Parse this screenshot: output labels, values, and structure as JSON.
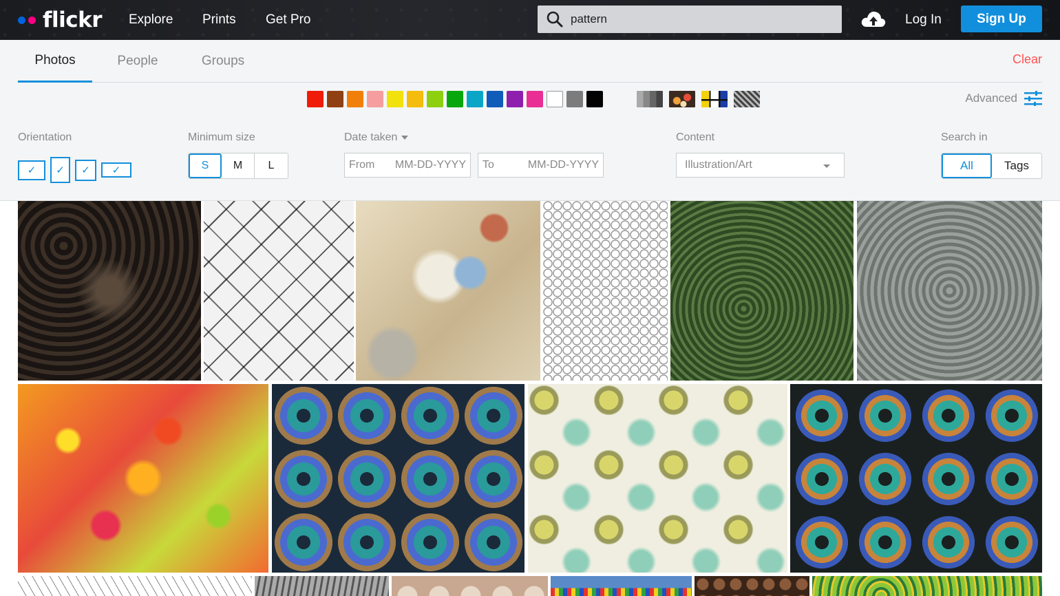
{
  "header": {
    "logo": "flickr",
    "nav": [
      "Explore",
      "Prints",
      "Get Pro"
    ],
    "search_value": "pattern",
    "login": "Log In",
    "signup": "Sign Up"
  },
  "tabs": [
    {
      "label": "Photos",
      "active": true
    },
    {
      "label": "People",
      "active": false
    },
    {
      "label": "Groups",
      "active": false
    }
  ],
  "clear_label": "Clear",
  "colors": [
    "#ee1c08",
    "#8f4114",
    "#f0800a",
    "#f49ea0",
    "#f1e10c",
    "#f4bc0c",
    "#8ed010",
    "#08a80d",
    "#0aa6c7",
    "#0f5cb9",
    "#8f20ad",
    "#e92f95",
    "#ffffff",
    "#7c7c7c",
    "#030303"
  ],
  "styles": [
    "black-and-white",
    "shallow-depth-of-field",
    "minimalist",
    "patterns"
  ],
  "advanced_label": "Advanced",
  "filters": {
    "orientation_label": "Orientation",
    "min_size_label": "Minimum size",
    "sizes": [
      "S",
      "M",
      "L"
    ],
    "date_label": "Date taken",
    "from_label": "From",
    "to_label": "To",
    "date_placeholder": "MM-DD-YYYY",
    "content_label": "Content",
    "content_value": "Illustration/Art",
    "search_in_label": "Search in",
    "search_in": [
      "All",
      "Tags"
    ]
  },
  "photos": [
    {
      "name": "dark-embossed-pattern"
    },
    {
      "name": "bw-geometric-pattern"
    },
    {
      "name": "vintage-collage-gentle-reminders"
    },
    {
      "name": "white-hexagon-pattern"
    },
    {
      "name": "green-embossed-pattern"
    },
    {
      "name": "grey-embossed-pattern"
    },
    {
      "name": "colorful-flower-pattern"
    },
    {
      "name": "blue-kaleidoscope-pattern"
    },
    {
      "name": "cream-floral-fabric"
    },
    {
      "name": "teal-orange-kaleidoscope"
    },
    {
      "name": "sketch-pattern"
    },
    {
      "name": "grey-leaf-pattern"
    },
    {
      "name": "beige-swirl-pattern"
    },
    {
      "name": "mosaic-tile-pattern"
    },
    {
      "name": "brown-circle-pattern"
    },
    {
      "name": "green-ornament-pattern"
    }
  ]
}
